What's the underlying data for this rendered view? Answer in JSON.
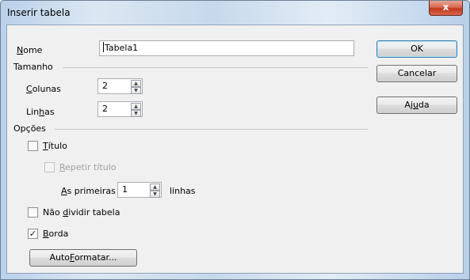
{
  "window": {
    "title": "Inserir tabela",
    "close_glyph": "x"
  },
  "name": {
    "label_u": "N",
    "label_rest": "ome",
    "value": "Tabela1"
  },
  "size": {
    "section_label": "Tamanho",
    "columns": {
      "label_u": "C",
      "label_rest": "olunas",
      "value": "2"
    },
    "rows": {
      "label_pre": "Lin",
      "label_u": "h",
      "label_rest": "as",
      "value": "2"
    }
  },
  "options": {
    "section_label": "Opções",
    "title": {
      "label_u": "T",
      "label_rest": "ítulo",
      "checked": false
    },
    "repeat_title": {
      "label_u": "R",
      "label_rest": "epetir título",
      "checked": false,
      "enabled": false
    },
    "first": {
      "label_u": "A",
      "label_rest": "s primeiras",
      "value": "1",
      "suffix": "linhas"
    },
    "no_split": {
      "label_pre": "Não ",
      "label_u": "d",
      "label_rest": "ividir tabela",
      "checked": false
    },
    "border": {
      "label_u": "B",
      "label_rest": "orda",
      "checked": true
    },
    "autoformat": {
      "label_pre": "Auto",
      "label_u": "F",
      "label_rest": "ormatar..."
    }
  },
  "buttons": {
    "ok": "OK",
    "cancel": "Cancelar",
    "help_pre": "Aj",
    "help_u": "u",
    "help_rest": "da"
  },
  "check_glyph": "✓",
  "spin_up_glyph": "▲",
  "spin_down_glyph": "▼"
}
